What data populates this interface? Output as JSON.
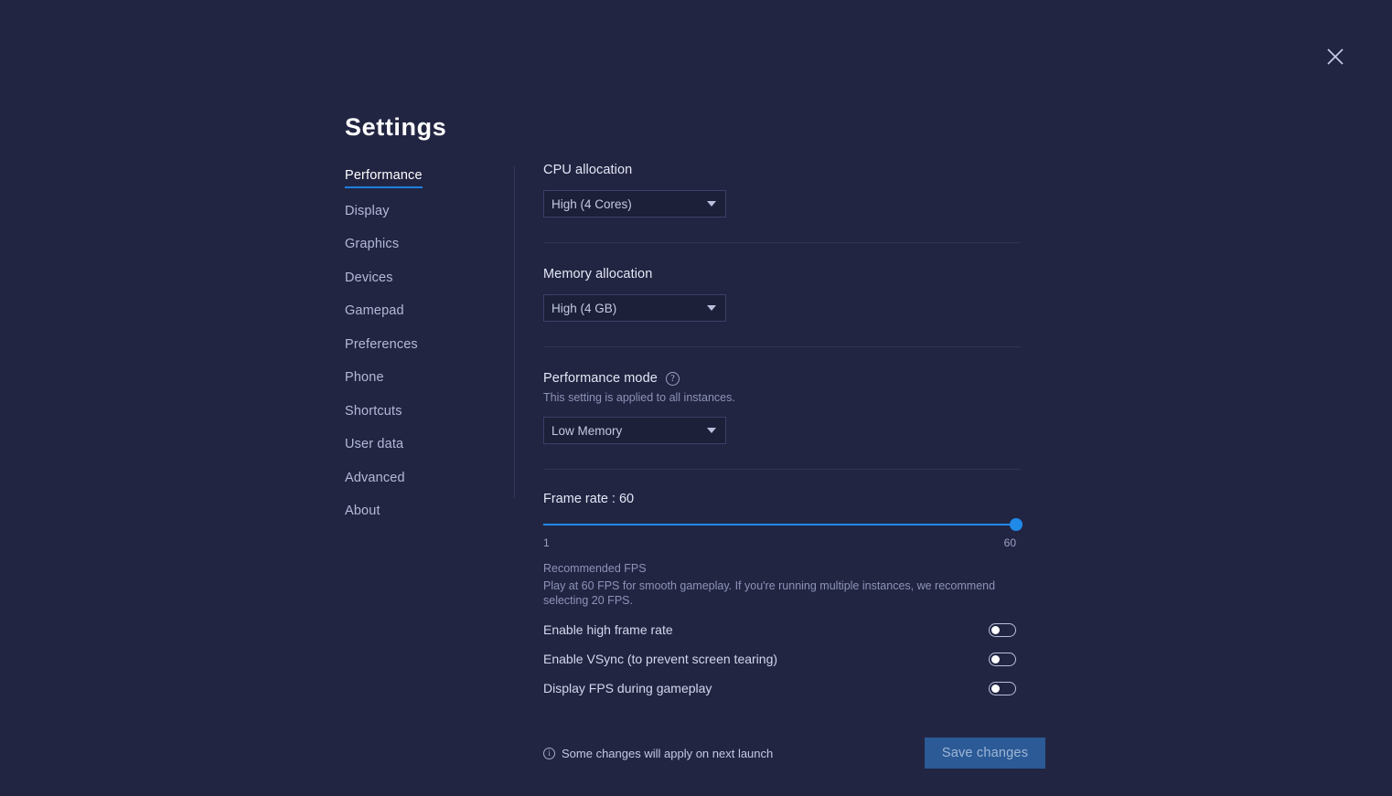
{
  "window": {
    "title": "Settings",
    "close_icon": "close-icon"
  },
  "sidebar": {
    "items": [
      {
        "label": "Performance",
        "active": true
      },
      {
        "label": "Display",
        "active": false
      },
      {
        "label": "Graphics",
        "active": false
      },
      {
        "label": "Devices",
        "active": false
      },
      {
        "label": "Gamepad",
        "active": false
      },
      {
        "label": "Preferences",
        "active": false
      },
      {
        "label": "Phone",
        "active": false
      },
      {
        "label": "Shortcuts",
        "active": false
      },
      {
        "label": "User data",
        "active": false
      },
      {
        "label": "Advanced",
        "active": false
      },
      {
        "label": "About",
        "active": false
      }
    ]
  },
  "content": {
    "cpu": {
      "label": "CPU allocation",
      "value": "High (4 Cores)"
    },
    "memory": {
      "label": "Memory allocation",
      "value": "High (4 GB)"
    },
    "performance_mode": {
      "label": "Performance mode",
      "help_icon": "question-mark-icon",
      "note": "This setting is applied to all instances.",
      "value": "Low Memory"
    },
    "frame_rate": {
      "label": "Frame rate : 60",
      "value": 60,
      "min": 1,
      "max": 60,
      "min_label": "1",
      "max_label": "60",
      "percent": "100%"
    },
    "recommended": {
      "title": "Recommended FPS",
      "body": "Play at 60 FPS for smooth gameplay. If you're running multiple instances, we recommend selecting 20 FPS."
    },
    "toggles": [
      {
        "label": "Enable high frame rate",
        "on": false
      },
      {
        "label": "Enable VSync (to prevent screen tearing)",
        "on": false
      },
      {
        "label": "Display FPS during gameplay",
        "on": false
      }
    ],
    "footer": {
      "info_icon": "info-icon",
      "note": "Some changes will apply on next launch",
      "save_label": "Save changes"
    }
  },
  "colors": {
    "background": "#222542",
    "accent": "#1f8ae8",
    "save_button": "#2b5a96",
    "panel": "#1c2038"
  }
}
